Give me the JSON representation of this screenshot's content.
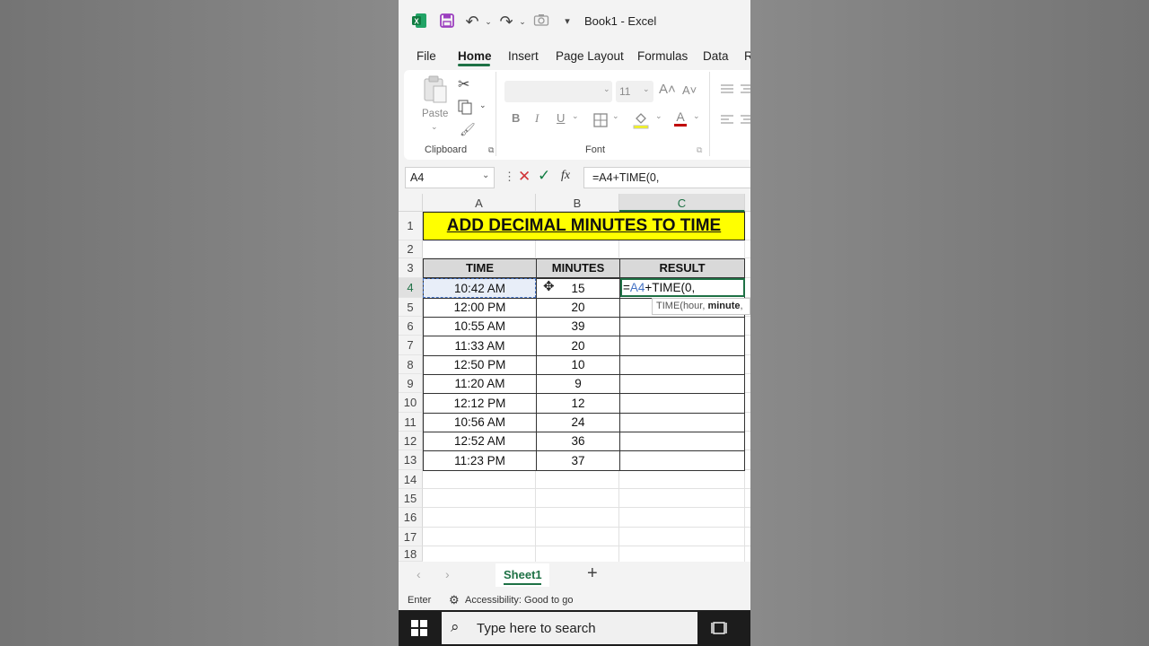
{
  "app": {
    "title": "Book1  -  Excel"
  },
  "menu": {
    "items": [
      "File",
      "Home",
      "Insert",
      "Page Layout",
      "Formulas",
      "Data",
      "R"
    ],
    "active": "Home"
  },
  "ribbon": {
    "paste_label": "Paste",
    "font_size": "11",
    "clipboard_label": "Clipboard",
    "font_label": "Font",
    "bold": "B",
    "italic": "I",
    "underline": "U"
  },
  "formula_bar": {
    "name_box": "A4",
    "fx": "fx",
    "formula": "=A4+TIME(0,"
  },
  "grid": {
    "columns": [
      "A",
      "B",
      "C"
    ],
    "rows": [
      "1",
      "2",
      "3",
      "4",
      "5",
      "6",
      "7",
      "8",
      "9",
      "10",
      "11",
      "12",
      "13",
      "14",
      "15",
      "16",
      "17",
      "18"
    ],
    "banner": "ADD DECIMAL MINUTES TO TIME",
    "headers": [
      "TIME",
      "MINUTES",
      "RESULT"
    ],
    "data": [
      [
        "10:42 AM",
        "15"
      ],
      [
        "12:00 PM",
        "20"
      ],
      [
        "10:55 AM",
        "39"
      ],
      [
        "11:33 AM",
        "20"
      ],
      [
        "12:50 PM",
        "10"
      ],
      [
        "11:20 AM",
        "9"
      ],
      [
        "12:12 PM",
        "12"
      ],
      [
        "10:56 AM",
        "24"
      ],
      [
        "12:52 AM",
        "36"
      ],
      [
        "11:23 PM",
        "37"
      ]
    ],
    "active_cell_text": {
      "eq": "=",
      "ref": "A4",
      "rest": "+TIME(0,"
    },
    "tooltip": {
      "func": "TIME(hour, ",
      "arg": "minute",
      "tail": ","
    }
  },
  "sheets": {
    "tabs": [
      "Sheet1"
    ],
    "add": "+"
  },
  "status": {
    "mode": "Enter",
    "accessibility": "Accessibility: Good to go"
  },
  "taskbar": {
    "search_placeholder": "Type here to search"
  },
  "colors": {
    "excel_green": "#1e7145",
    "banner_yellow": "#ffff00",
    "ref_blue": "#4472c4",
    "save_purple": "#9b3fbf"
  }
}
